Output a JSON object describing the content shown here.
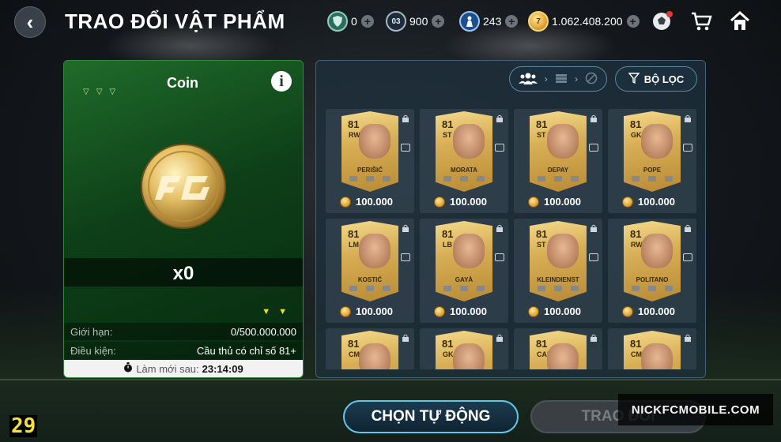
{
  "header": {
    "title": "TRAO ĐỔI VẬT PHẨM",
    "currencies": [
      {
        "icon": "shield-token-icon",
        "value": "0"
      },
      {
        "icon": "bp-token-icon",
        "value": "900"
      },
      {
        "icon": "player-token-icon",
        "value": "243"
      },
      {
        "icon": "coin-icon",
        "value": "1.062.408.200"
      }
    ]
  },
  "left_panel": {
    "title": "Coin",
    "quantity": "x0",
    "limit_label": "Giới hạn:",
    "limit_value": "0/500.000.000",
    "condition_label": "Điều kiện:",
    "condition_value": "Cầu thủ có chỉ số 81+",
    "refresh_label": "Làm mới sau:",
    "refresh_value": "23:14:09"
  },
  "filter": {
    "label": "BỘ LỌC"
  },
  "cards": [
    {
      "ovr": "81",
      "pos": "RW",
      "name": "PERIŠIĆ",
      "price": "100.000"
    },
    {
      "ovr": "81",
      "pos": "ST",
      "name": "MORATA",
      "price": "100.000"
    },
    {
      "ovr": "81",
      "pos": "ST",
      "name": "DEPAY",
      "price": "100.000"
    },
    {
      "ovr": "81",
      "pos": "GK",
      "name": "POPE",
      "price": "100.000"
    },
    {
      "ovr": "81",
      "pos": "LM",
      "name": "KOSTIĆ",
      "price": "100.000"
    },
    {
      "ovr": "81",
      "pos": "LB",
      "name": "GAYÀ",
      "price": "100.000"
    },
    {
      "ovr": "81",
      "pos": "ST",
      "name": "KLEINDIENST",
      "price": "100.000"
    },
    {
      "ovr": "81",
      "pos": "RW",
      "name": "POLITANO",
      "price": "100.000"
    },
    {
      "ovr": "81",
      "pos": "CM",
      "name": "",
      "price": ""
    },
    {
      "ovr": "81",
      "pos": "GK",
      "name": "",
      "price": ""
    },
    {
      "ovr": "81",
      "pos": "CAM",
      "name": "",
      "price": ""
    },
    {
      "ovr": "81",
      "pos": "CM",
      "name": "",
      "price": ""
    }
  ],
  "buttons": {
    "auto_select": "CHỌN TỰ ĐỘNG",
    "trade": "TRAO ĐỔI"
  },
  "overlay": {
    "watermark": "NICKFCMOBILE.COM",
    "fps": "29"
  }
}
